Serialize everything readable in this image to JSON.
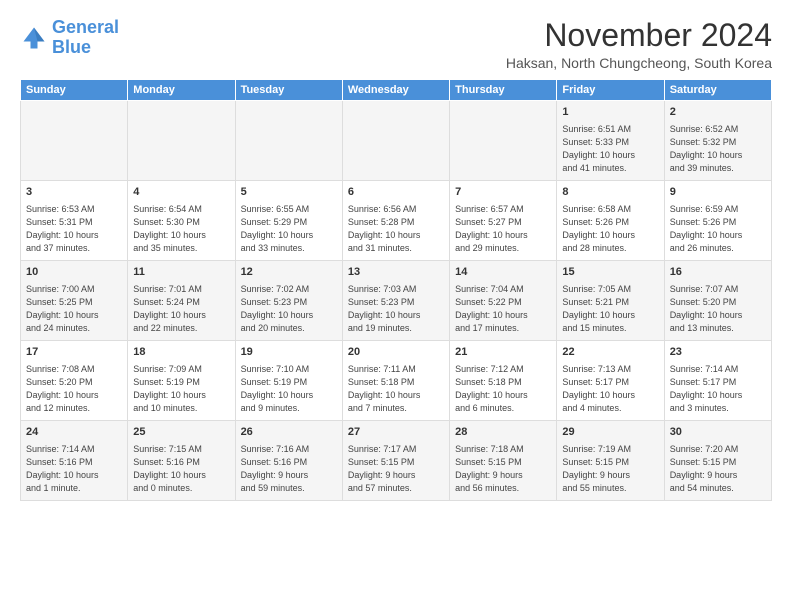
{
  "logo": {
    "line1": "General",
    "line2": "Blue"
  },
  "title": "November 2024",
  "subtitle": "Haksan, North Chungcheong, South Korea",
  "weekdays": [
    "Sunday",
    "Monday",
    "Tuesday",
    "Wednesday",
    "Thursday",
    "Friday",
    "Saturday"
  ],
  "weeks": [
    [
      {
        "day": "",
        "info": ""
      },
      {
        "day": "",
        "info": ""
      },
      {
        "day": "",
        "info": ""
      },
      {
        "day": "",
        "info": ""
      },
      {
        "day": "",
        "info": ""
      },
      {
        "day": "1",
        "info": "Sunrise: 6:51 AM\nSunset: 5:33 PM\nDaylight: 10 hours\nand 41 minutes."
      },
      {
        "day": "2",
        "info": "Sunrise: 6:52 AM\nSunset: 5:32 PM\nDaylight: 10 hours\nand 39 minutes."
      }
    ],
    [
      {
        "day": "3",
        "info": "Sunrise: 6:53 AM\nSunset: 5:31 PM\nDaylight: 10 hours\nand 37 minutes."
      },
      {
        "day": "4",
        "info": "Sunrise: 6:54 AM\nSunset: 5:30 PM\nDaylight: 10 hours\nand 35 minutes."
      },
      {
        "day": "5",
        "info": "Sunrise: 6:55 AM\nSunset: 5:29 PM\nDaylight: 10 hours\nand 33 minutes."
      },
      {
        "day": "6",
        "info": "Sunrise: 6:56 AM\nSunset: 5:28 PM\nDaylight: 10 hours\nand 31 minutes."
      },
      {
        "day": "7",
        "info": "Sunrise: 6:57 AM\nSunset: 5:27 PM\nDaylight: 10 hours\nand 29 minutes."
      },
      {
        "day": "8",
        "info": "Sunrise: 6:58 AM\nSunset: 5:26 PM\nDaylight: 10 hours\nand 28 minutes."
      },
      {
        "day": "9",
        "info": "Sunrise: 6:59 AM\nSunset: 5:26 PM\nDaylight: 10 hours\nand 26 minutes."
      }
    ],
    [
      {
        "day": "10",
        "info": "Sunrise: 7:00 AM\nSunset: 5:25 PM\nDaylight: 10 hours\nand 24 minutes."
      },
      {
        "day": "11",
        "info": "Sunrise: 7:01 AM\nSunset: 5:24 PM\nDaylight: 10 hours\nand 22 minutes."
      },
      {
        "day": "12",
        "info": "Sunrise: 7:02 AM\nSunset: 5:23 PM\nDaylight: 10 hours\nand 20 minutes."
      },
      {
        "day": "13",
        "info": "Sunrise: 7:03 AM\nSunset: 5:23 PM\nDaylight: 10 hours\nand 19 minutes."
      },
      {
        "day": "14",
        "info": "Sunrise: 7:04 AM\nSunset: 5:22 PM\nDaylight: 10 hours\nand 17 minutes."
      },
      {
        "day": "15",
        "info": "Sunrise: 7:05 AM\nSunset: 5:21 PM\nDaylight: 10 hours\nand 15 minutes."
      },
      {
        "day": "16",
        "info": "Sunrise: 7:07 AM\nSunset: 5:20 PM\nDaylight: 10 hours\nand 13 minutes."
      }
    ],
    [
      {
        "day": "17",
        "info": "Sunrise: 7:08 AM\nSunset: 5:20 PM\nDaylight: 10 hours\nand 12 minutes."
      },
      {
        "day": "18",
        "info": "Sunrise: 7:09 AM\nSunset: 5:19 PM\nDaylight: 10 hours\nand 10 minutes."
      },
      {
        "day": "19",
        "info": "Sunrise: 7:10 AM\nSunset: 5:19 PM\nDaylight: 10 hours\nand 9 minutes."
      },
      {
        "day": "20",
        "info": "Sunrise: 7:11 AM\nSunset: 5:18 PM\nDaylight: 10 hours\nand 7 minutes."
      },
      {
        "day": "21",
        "info": "Sunrise: 7:12 AM\nSunset: 5:18 PM\nDaylight: 10 hours\nand 6 minutes."
      },
      {
        "day": "22",
        "info": "Sunrise: 7:13 AM\nSunset: 5:17 PM\nDaylight: 10 hours\nand 4 minutes."
      },
      {
        "day": "23",
        "info": "Sunrise: 7:14 AM\nSunset: 5:17 PM\nDaylight: 10 hours\nand 3 minutes."
      }
    ],
    [
      {
        "day": "24",
        "info": "Sunrise: 7:14 AM\nSunset: 5:16 PM\nDaylight: 10 hours\nand 1 minute."
      },
      {
        "day": "25",
        "info": "Sunrise: 7:15 AM\nSunset: 5:16 PM\nDaylight: 10 hours\nand 0 minutes."
      },
      {
        "day": "26",
        "info": "Sunrise: 7:16 AM\nSunset: 5:16 PM\nDaylight: 9 hours\nand 59 minutes."
      },
      {
        "day": "27",
        "info": "Sunrise: 7:17 AM\nSunset: 5:15 PM\nDaylight: 9 hours\nand 57 minutes."
      },
      {
        "day": "28",
        "info": "Sunrise: 7:18 AM\nSunset: 5:15 PM\nDaylight: 9 hours\nand 56 minutes."
      },
      {
        "day": "29",
        "info": "Sunrise: 7:19 AM\nSunset: 5:15 PM\nDaylight: 9 hours\nand 55 minutes."
      },
      {
        "day": "30",
        "info": "Sunrise: 7:20 AM\nSunset: 5:15 PM\nDaylight: 9 hours\nand 54 minutes."
      }
    ]
  ]
}
